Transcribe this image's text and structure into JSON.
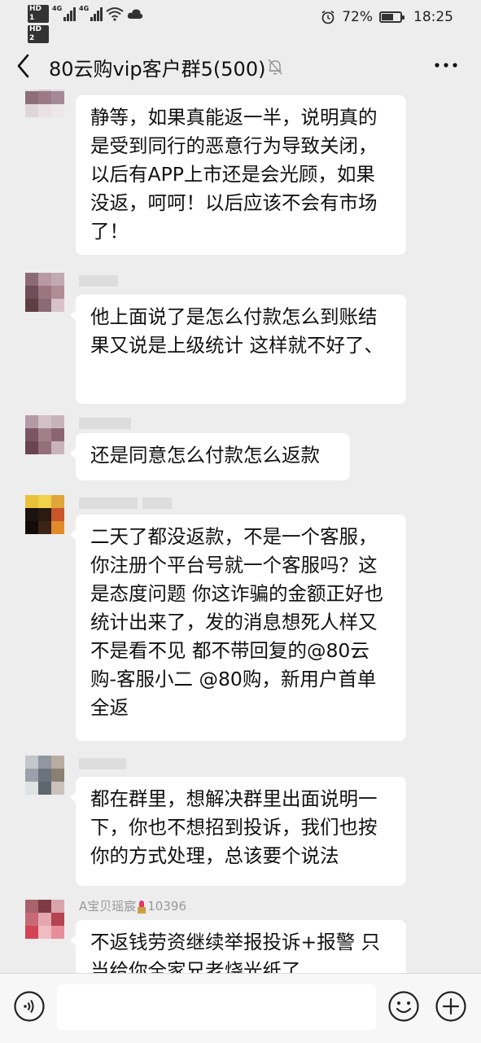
{
  "status_bar": {
    "hd1": "HD 1",
    "hd2": "HD 2",
    "net1": "4G",
    "net2": "4G",
    "battery": "72%",
    "battery_level": 0.72,
    "time": "18:25"
  },
  "header": {
    "title": "80云购vip客户群5(500)",
    "icons": [
      "back-icon",
      "mute-bell-icon",
      "more-icon"
    ]
  },
  "messages": [
    {
      "name": "",
      "text": "静等，如果真能返一半，说明真的是受到同行的恶意行为导致关闭，以后有APP上市还是会光顾，如果没返，呵呵！以后应该不会有市场了！"
    },
    {
      "name": "",
      "text": "他上面说了是怎么付款怎么到账结果又说是上级统计 这样就不好了、"
    },
    {
      "name": "",
      "text": "还是同意怎么付款怎么返款"
    },
    {
      "name": "",
      "text": "二天了都没返款，不是一个客服，你注册个平台号就一个客服吗？这是态度问题 你这诈骗的金额正好也统计出来了，发的消息想死人样又不是看不见 都不带回复的@80云购-客服小二 @80购，新用户首单全返"
    },
    {
      "name": "",
      "text": "都在群里，想解决群里出面说明一下，你也不想招到投诉，我们也按你的方式处理，总该要个说法"
    },
    {
      "name": "A宝贝瑶宸",
      "name_suffix": "10396",
      "text": "不返钱劳资继续举报投诉+报警 只当给你全家兄老烧光纸了"
    }
  ],
  "input_bar": {
    "placeholder": "",
    "icons": [
      "voice-icon",
      "emoji-icon",
      "plus-icon"
    ]
  }
}
